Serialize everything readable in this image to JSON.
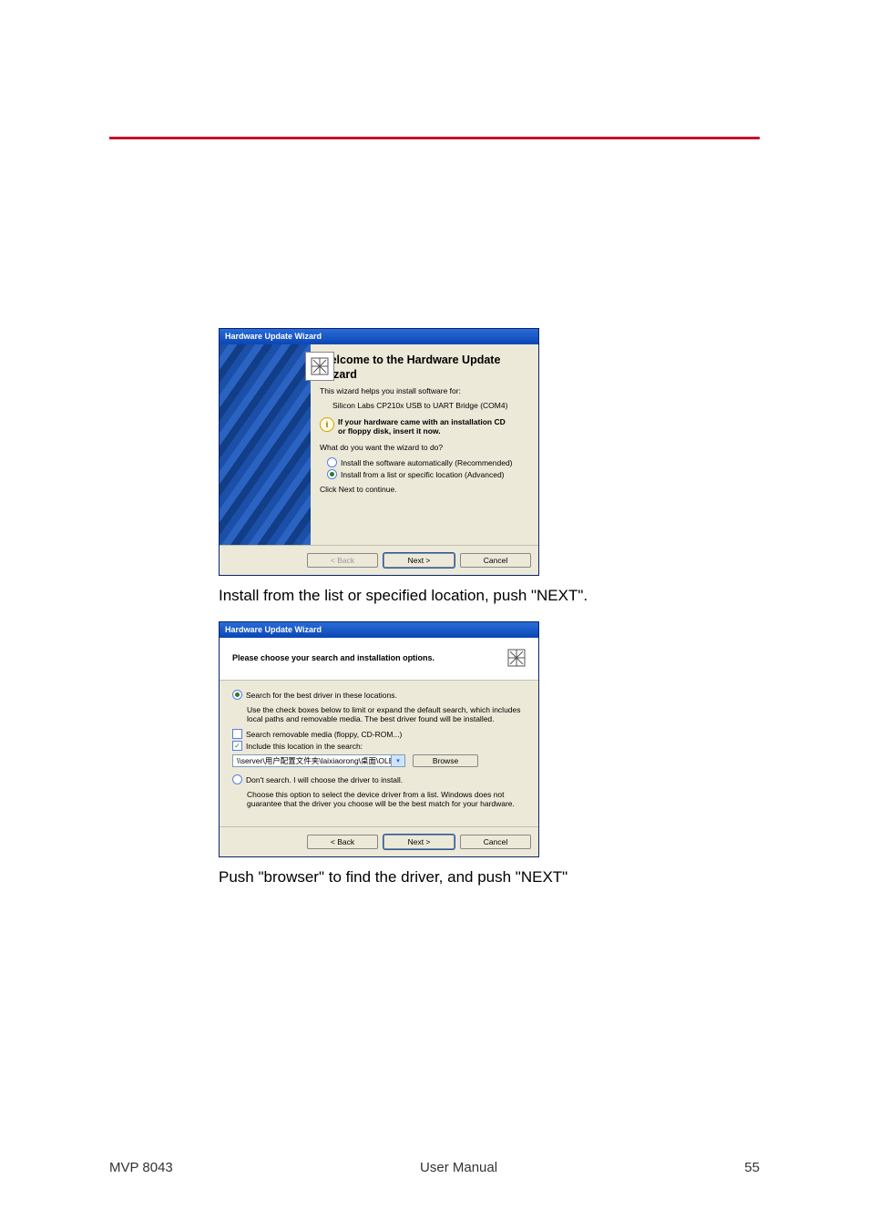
{
  "rule_color": "#c8102e",
  "caption1": "Install from the list or specified location, push \"NEXT\".",
  "caption2": "Push \"browser\" to find the driver, and push \"NEXT\"",
  "footer": {
    "left": "MVP 8043",
    "center": "User Manual",
    "right": "55"
  },
  "wizard1": {
    "title": "Hardware Update Wizard",
    "heading_l1": "Welcome to the Hardware Update",
    "heading_l2": "Wizard",
    "p1": "This wizard helps you install software for:",
    "device": "Silicon Labs CP210x USB to UART Bridge (COM4)",
    "info_l1": "If your hardware came with an installation CD",
    "info_l2": "or floppy disk, insert it now.",
    "q": "What do you want the wizard to do?",
    "opt1": "Install the software automatically (Recommended)",
    "opt2": "Install from a list or specific location (Advanced)",
    "cont": "Click Next to continue.",
    "btn_back": "< Back",
    "btn_next": "Next >",
    "btn_cancel": "Cancel"
  },
  "wizard2": {
    "title": "Hardware Update Wizard",
    "header": "Please choose your search and installation options.",
    "optA": "Search for the best driver in these locations.",
    "desc1": "Use the check boxes below to limit or expand the default search, which includes local paths and removable media. The best driver found will be installed.",
    "cb1": "Search removable media (floppy, CD-ROM...)",
    "cb2": "Include this location in the search:",
    "path": "\\\\server\\用户配置文件夹\\laixiaorong\\桌面\\OLED",
    "browse": "Browse",
    "optB": "Don't search. I will choose the driver to install.",
    "desc2": "Choose this option to select the device driver from a list.  Windows does not guarantee that the driver you choose will be the best match for your hardware.",
    "btn_back": "< Back",
    "btn_next": "Next >",
    "btn_cancel": "Cancel"
  }
}
